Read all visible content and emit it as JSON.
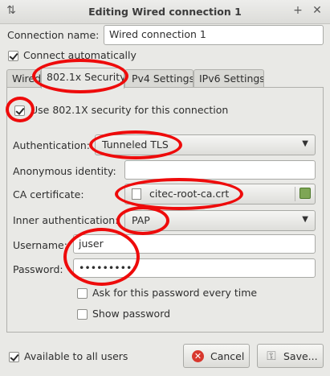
{
  "window": {
    "title": "Editing Wired connection 1",
    "maximize_glyph": "+",
    "close_glyph": "✕",
    "app_icon": "network-icon"
  },
  "connection": {
    "name_label": "Connection name:",
    "name_value": "Wired connection 1",
    "auto_connect_label": "Connect automatically",
    "auto_connect_checked": true
  },
  "tabs": [
    {
      "label": "Wired",
      "active": false
    },
    {
      "label": "802.1x Security",
      "active": true
    },
    {
      "label": "Pv4 Settings",
      "active": false
    },
    {
      "label": "IPv6 Settings",
      "active": false
    }
  ],
  "security": {
    "use_8021x_label": "Use 802.1X security for this connection",
    "use_8021x_checked": true,
    "authentication_label": "Authentication:",
    "authentication_value": "Tunneled TLS",
    "anonymous_identity_label": "Anonymous identity:",
    "anonymous_identity_value": "",
    "ca_certificate_label": "CA certificate:",
    "ca_certificate_value": "citec-root-ca.crt",
    "inner_auth_label": "Inner authentication:",
    "inner_auth_value": "PAP",
    "username_label": "Username:",
    "username_value": "juser",
    "password_label": "Password:",
    "password_value": "••••••••••",
    "ask_password_label": "Ask for this password every time",
    "ask_password_checked": false,
    "show_password_label": "Show password",
    "show_password_checked": false
  },
  "footer": {
    "all_users_label": "Available to all users",
    "all_users_checked": true,
    "cancel_label": "Cancel",
    "save_label": "Save..."
  },
  "highlight_color": "#ee0b0b"
}
